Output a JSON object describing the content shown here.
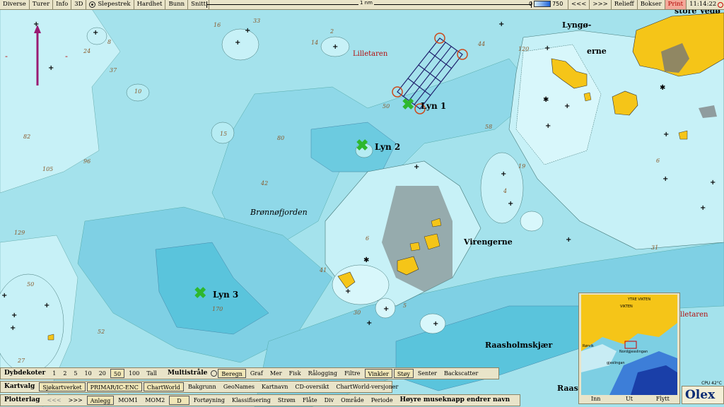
{
  "toolbar": {
    "items": [
      "Diverse",
      "Turer",
      "Info",
      "3D",
      "Slepestrek",
      "Hardhet",
      "Bunn",
      "Snitt"
    ],
    "scale_label": "1 nm",
    "depth_min": "0",
    "depth_max": "750",
    "nav_prev": "<<<",
    "nav_next": ">>>",
    "relief": "Relieff",
    "boxes": "Bokser",
    "print": "Print",
    "time": "11:14:22"
  },
  "map": {
    "places": {
      "lillelaren": "Lilletaren",
      "lyngo": "Lyngø-",
      "erne": "erne",
      "store_vedo": "store Vedø",
      "bronnofjorden": "Brønnøfjorden",
      "virengerne": "Virengerne",
      "raasholmskjaer": "Raasholmskjær",
      "raas": "Raas",
      "lilletaren2": "lletaren"
    },
    "marks": [
      {
        "id": "lyn1",
        "label": "Lyn 1"
      },
      {
        "id": "lyn2",
        "label": "Lyn 2"
      },
      {
        "id": "lyn3",
        "label": "Lyn 3"
      }
    ],
    "depths": [
      "16",
      "33",
      "24",
      "8",
      "37",
      "10",
      "2",
      "14",
      "44",
      "120",
      "50",
      "15",
      "80",
      "58",
      "82",
      "105",
      "96",
      "42",
      "19",
      "129",
      "41",
      "6",
      "5",
      "30",
      "4",
      "52",
      "27",
      "50",
      "170",
      "31",
      "6"
    ]
  },
  "bottom": {
    "row1": {
      "head": "Dybdekoter",
      "values": [
        "1",
        "2",
        "5",
        "10",
        "20",
        "50",
        "100",
        "Tall"
      ],
      "selected": "50",
      "multi_head": "Multistråle",
      "multi_items": [
        "Beregn",
        "Graf",
        "Mer",
        "Fisk",
        "Rålogging",
        "Filtre",
        "Vinkler",
        "Støy",
        "Senter",
        "Backscatter"
      ]
    },
    "row2": {
      "head": "Kartvalg",
      "items": [
        "Sjøkartverket",
        "PRIMAR/IC-ENC",
        "ChartWorld",
        "Bakgrunn",
        "GeoNames",
        "Kartnavn",
        "CD-oversikt",
        "ChartWorld-versjoner"
      ]
    },
    "row3": {
      "head": "Plotterlag",
      "nav_prev": "<<<",
      "nav_next": ">>>",
      "items": [
        "Anlegg",
        "MOM1",
        "MOM2",
        "D",
        "Fortøyning",
        "Klassifisering",
        "Strøm",
        "Flåte",
        "Div",
        "Område",
        "Periode"
      ],
      "hint": "Høyre museknapp endrer navn"
    }
  },
  "overview": {
    "labels": [
      "YTRE VIKTEN",
      "VIKTEN",
      "Nordgjesslingan",
      "gjeslingan",
      "Rørvik"
    ],
    "btn_in": "Inn",
    "btn_out": "Ut",
    "btn_move": "Flytt"
  },
  "brand": {
    "logo": "Olex",
    "cpu": "CPU 42°C"
  },
  "colors": {
    "land": "#f5c518",
    "shallow": "#c4f0f6",
    "mid": "#8fdcea",
    "deep": "#55c7dc",
    "route": "#21246f",
    "x_mark": "#2eb82e"
  }
}
